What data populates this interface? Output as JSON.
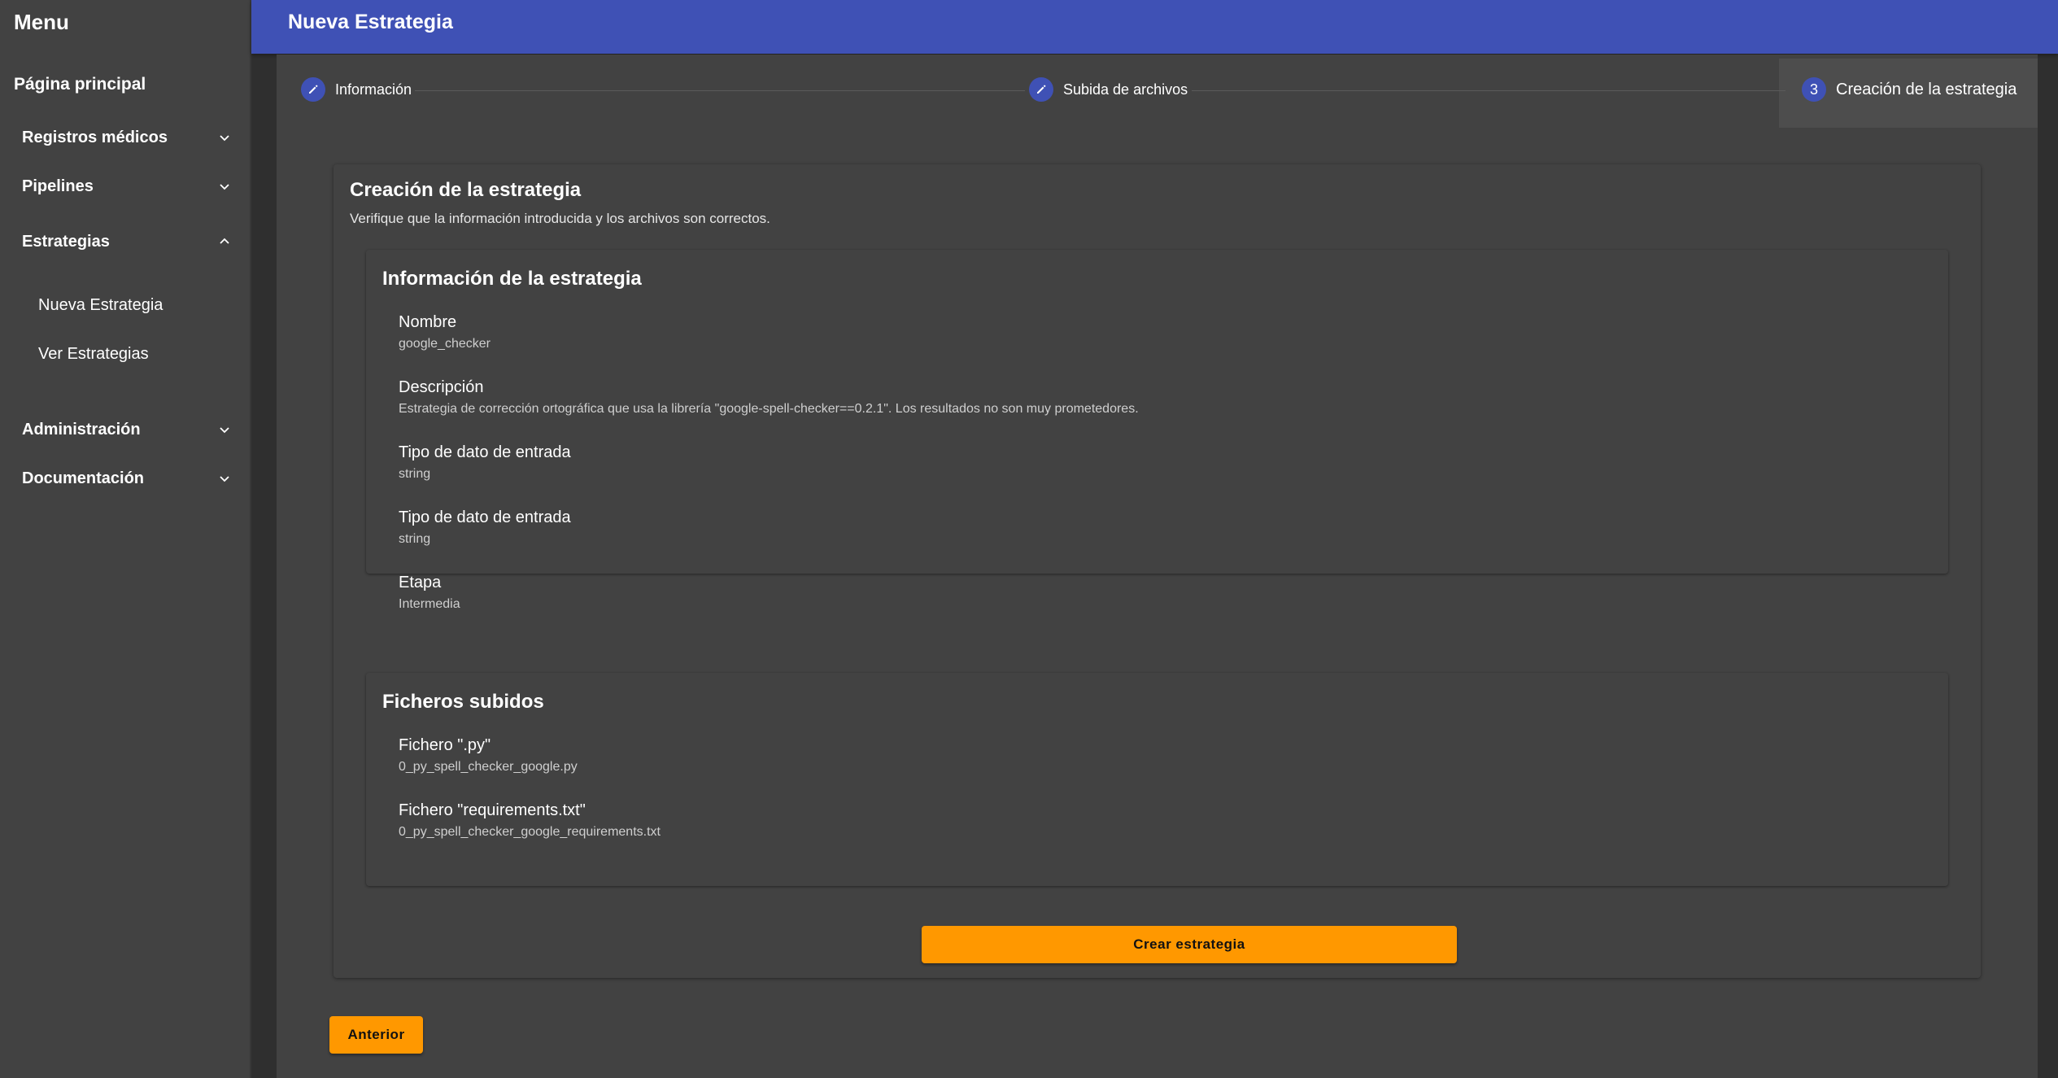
{
  "sidebar": {
    "title": "Menu",
    "home": "Página principal",
    "groups": [
      {
        "label": "Registros médicos",
        "expanded": false
      },
      {
        "label": "Pipelines",
        "expanded": false
      },
      {
        "label": "Estrategias",
        "expanded": true
      },
      {
        "label": "Administración",
        "expanded": false
      },
      {
        "label": "Documentación",
        "expanded": false
      }
    ],
    "estrategias_items": [
      "Nueva Estrategia",
      "Ver Estrategias"
    ]
  },
  "header": {
    "title": "Nueva Estrategia"
  },
  "stepper": {
    "steps": [
      {
        "label": "Información",
        "state": "edit"
      },
      {
        "label": "Subida de archivos",
        "state": "edit"
      },
      {
        "label": "Creación de la estrategia",
        "state": "active",
        "number": "3"
      }
    ]
  },
  "card": {
    "title": "Creación de la estrategia",
    "subtitle": "Verifique que la información introducida y los archivos son correctos."
  },
  "info_panel": {
    "title": "Información de la estrategia",
    "fields": [
      {
        "label": "Nombre",
        "value": "google_checker"
      },
      {
        "label": "Descripción",
        "value": "Estrategia de corrección ortográfica que usa la librería \"google-spell-checker==0.2.1\". Los resultados no son muy prometedores."
      },
      {
        "label": "Tipo de dato de entrada",
        "value": "string"
      },
      {
        "label": "Tipo de dato de entrada",
        "value": "string"
      },
      {
        "label": "Etapa",
        "value": "Intermedia"
      }
    ]
  },
  "files_panel": {
    "title": "Ficheros subidos",
    "fields": [
      {
        "label": "Fichero \".py\"",
        "value": "0_py_spell_checker_google.py"
      },
      {
        "label": "Fichero \"requirements.txt\"",
        "value": "0_py_spell_checker_google_requirements.txt"
      }
    ]
  },
  "buttons": {
    "create": "Crear estrategia",
    "previous": "Anterior"
  },
  "colors": {
    "primary": "#3f51b5",
    "accent": "#ff9800",
    "surface": "#424242",
    "background": "#2f2f2f"
  }
}
